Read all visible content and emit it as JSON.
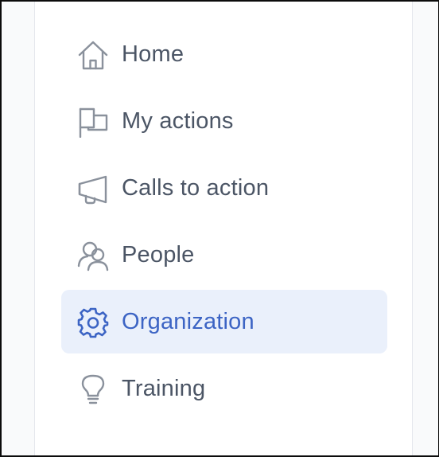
{
  "nav": {
    "items": [
      {
        "label": "Home",
        "icon": "home-icon",
        "active": false
      },
      {
        "label": "My actions",
        "icon": "flag-icon",
        "active": false
      },
      {
        "label": "Calls to action",
        "icon": "megaphone-icon",
        "active": false
      },
      {
        "label": "People",
        "icon": "people-icon",
        "active": false
      },
      {
        "label": "Organization",
        "icon": "gear-icon",
        "active": true
      },
      {
        "label": "Training",
        "icon": "lightbulb-icon",
        "active": false
      }
    ]
  },
  "colors": {
    "text": "#4b5565",
    "icon": "#8a919c",
    "active_text": "#3c64c4",
    "active_bg": "#eaf0fb"
  }
}
